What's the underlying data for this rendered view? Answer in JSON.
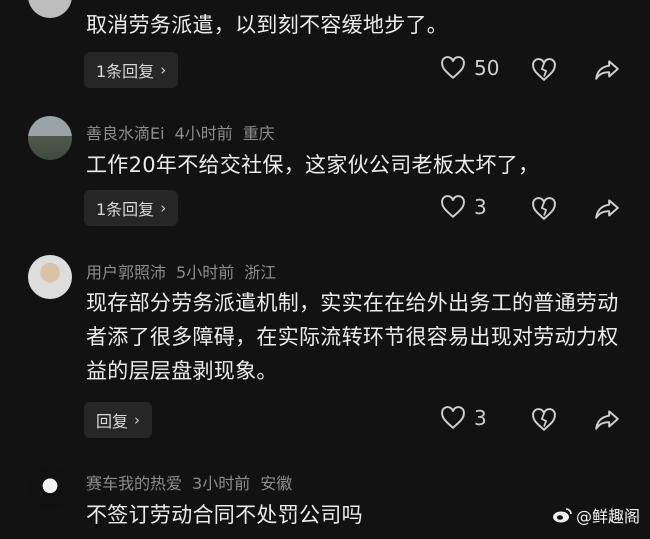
{
  "comments": [
    {
      "text": "取消劳务派遣，以到刻不容缓地步了。",
      "reply_label": "1条回复",
      "likes": "50"
    },
    {
      "user": "善良水滴Ei",
      "time": "4小时前",
      "location": "重庆",
      "text": "工作20年不给交社保，这家伙公司老板太坏了，",
      "reply_label": "1条回复",
      "likes": "3"
    },
    {
      "user": "用户郭照沛",
      "time": "5小时前",
      "location": "浙江",
      "text": "现存部分劳务派遣机制，实实在在给外出务工的普通劳动者添了很多障碍，在实际流转环节很容易出现对劳动力权益的层层盘剥现象。",
      "reply_label": "回复",
      "likes": "3"
    },
    {
      "user": "赛车我的热爱",
      "time": "3小时前",
      "location": "安徽",
      "text": "不签订劳动合同不处罚公司吗"
    }
  ],
  "watermark": "@鲜趣阁",
  "colors": {
    "background": "#121212",
    "meta": "#8c8c8c",
    "text": "#ececec",
    "button_bg": "#262626"
  },
  "icons": [
    "heart-outline-icon",
    "broken-heart-icon",
    "share-arrow-icon",
    "chevron-right-icon"
  ]
}
